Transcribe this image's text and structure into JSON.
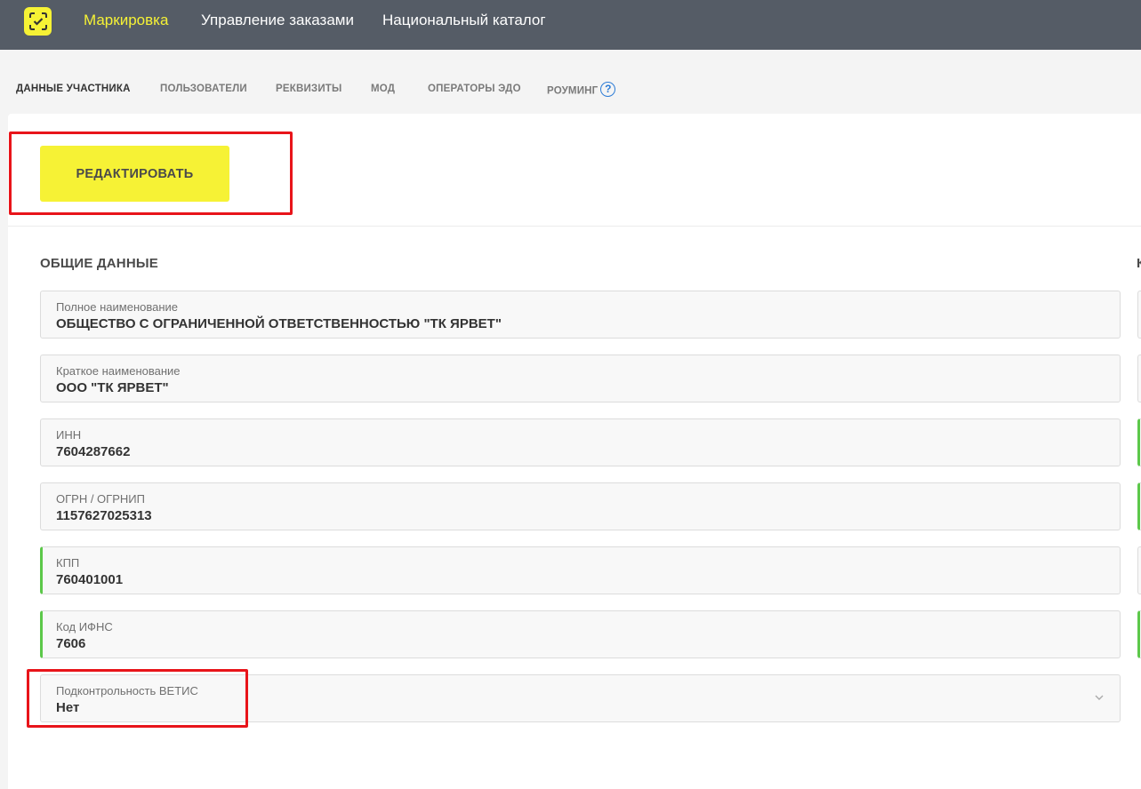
{
  "header": {
    "nav": [
      {
        "label": "Маркировка",
        "active": true
      },
      {
        "label": "Управление заказами",
        "active": false
      },
      {
        "label": "Национальный каталог",
        "active": false
      }
    ],
    "accent_color": "#f6f235",
    "bar_color": "#555c66"
  },
  "subnav": {
    "tabs": [
      {
        "label": "ДАННЫЕ УЧАСТНИКА",
        "active": true
      },
      {
        "label": "ПОЛЬЗОВАТЕЛИ",
        "active": false
      },
      {
        "label": "РЕКВИЗИТЫ",
        "active": false
      },
      {
        "label": "МОД",
        "active": false
      },
      {
        "label": "ОПЕРАТОРЫ ЭДО",
        "active": false
      },
      {
        "label": "РОУМИНГ",
        "active": false,
        "icon": "help-circle-icon"
      }
    ],
    "help_glyph": "?"
  },
  "toolbar": {
    "edit_label": "РЕДАКТИРОВАТЬ"
  },
  "general": {
    "title": "ОБЩИЕ ДАННЫЕ",
    "right_title_fragment": "К",
    "fields": [
      {
        "label": "Полное наименование",
        "value": "ОБЩЕСТВО С ОГРАНИЧЕННОЙ ОТВЕТСТВЕННОСТЬЮ \"ТК ЯРВЕТ\"",
        "valid": false
      },
      {
        "label": "Краткое наименование",
        "value": "ООО \"ТК ЯРВЕТ\"",
        "valid": false
      },
      {
        "label": "ИНН",
        "value": "7604287662",
        "valid": false
      },
      {
        "label": "ОГРН / ОГРНИП",
        "value": "1157627025313",
        "valid": false
      },
      {
        "label": "КПП",
        "value": "760401001",
        "valid": true
      },
      {
        "label": "Код ИФНС",
        "value": "7606",
        "valid": true
      },
      {
        "label": "Подконтрольность ВЕТИС",
        "value": "Нет",
        "valid": false,
        "dropdown": true
      }
    ],
    "valid_color": "#5cc84a"
  },
  "annotations": {
    "highlight_color": "#e8141a"
  }
}
